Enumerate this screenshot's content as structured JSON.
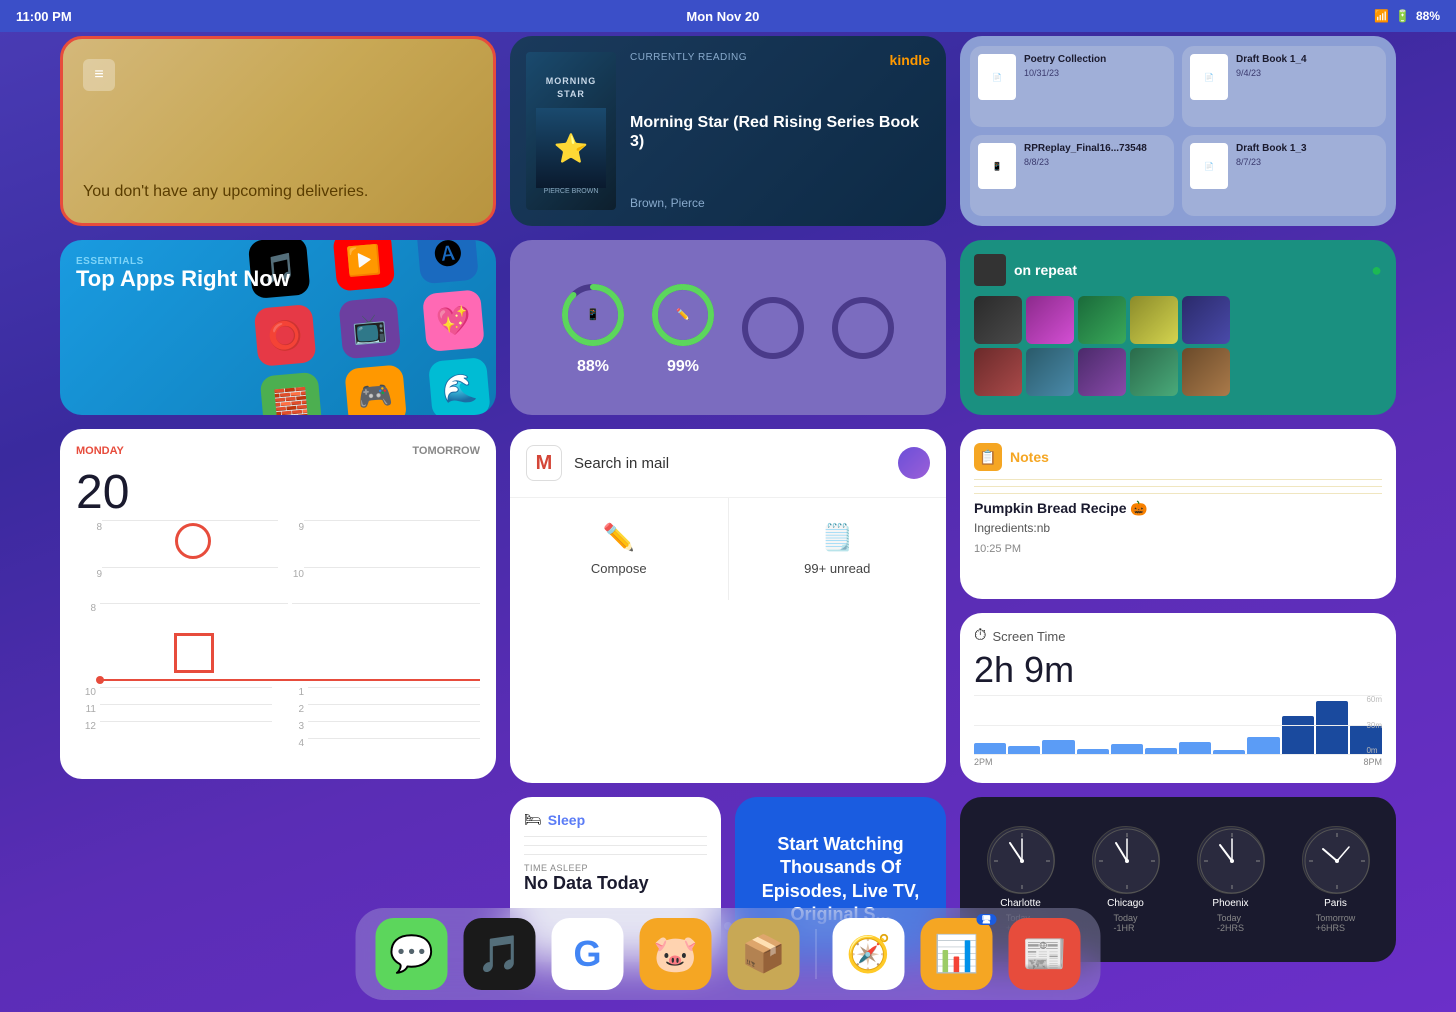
{
  "statusBar": {
    "time": "11:00 PM",
    "date": "Mon Nov 20",
    "wifi": "WiFi",
    "battery": "88%"
  },
  "delivery": {
    "message": "You don't have any upcoming deliveries."
  },
  "kindle": {
    "label": "CURRENTLY READING",
    "title": "Morning Star (Red Rising Series Book 3)",
    "author": "Brown, Pierce",
    "logo": "kindle"
  },
  "files": {
    "items": [
      {
        "name": "Poetry Collection",
        "date": "10/31/23"
      },
      {
        "name": "Draft Book 1_4",
        "date": "9/4/23"
      },
      {
        "name": "RPReplay_Final16...73548",
        "date": "8/8/23"
      },
      {
        "name": "Draft Book 1_3",
        "date": "8/7/23"
      }
    ]
  },
  "appstore": {
    "label": "ESSENTIALS",
    "title": "Top Apps Right Now"
  },
  "battery": {
    "devices": [
      {
        "pct": 88,
        "icon": "📱"
      },
      {
        "pct": 99,
        "icon": "✏️"
      }
    ]
  },
  "spotify": {
    "title": "on repeat"
  },
  "calendar": {
    "day": "MONDAY",
    "tomorrow": "TOMORROW",
    "date": "20",
    "times": [
      "8",
      "9",
      "10",
      "11",
      "12",
      "1",
      "2",
      "3",
      "4"
    ]
  },
  "gmail": {
    "placeholder": "Search in mail",
    "actions": [
      {
        "label": "Compose",
        "icon": "✏️"
      },
      {
        "label": "99+ unread",
        "icon": "📋"
      }
    ]
  },
  "notes": {
    "title": "Notes",
    "noteTitle": "Pumpkin Bread Recipe 🎃",
    "content": "Ingredients:nb",
    "time": "10:25 PM"
  },
  "screentime": {
    "title": "Screen Time",
    "duration": "2h 9m",
    "labels": [
      "2PM",
      "8PM"
    ],
    "gridLabels": [
      "60m",
      "30m",
      "0m"
    ]
  },
  "sleep": {
    "title": "Sleep",
    "sublabel": "TIME ASLEEP",
    "value": "No Data Today"
  },
  "ad": {
    "text": "Start Watching Thousands Of Episodes, Live TV, Original S..."
  },
  "clocks": [
    {
      "city": "Charlotte",
      "sub": "Today\n+0HRS"
    },
    {
      "city": "Chicago",
      "sub": "Today\n-1HR"
    },
    {
      "city": "Phoenix",
      "sub": "Today\n-2HRS"
    },
    {
      "city": "Paris",
      "sub": "Tomorrow\n+6HRS"
    }
  ],
  "dots": [
    true,
    false,
    false
  ],
  "dock": {
    "apps": [
      {
        "label": "Messages",
        "icon": "💬",
        "bg": "#5cd65c"
      },
      {
        "label": "Spotify",
        "icon": "🎵",
        "bg": "#1a1a1a"
      },
      {
        "label": "Google",
        "icon": "G",
        "bg": "white"
      },
      {
        "label": "Money",
        "icon": "🐷",
        "bg": "#f5a623"
      },
      {
        "label": "Deliveries",
        "icon": "📦",
        "bg": "#c8a855"
      },
      {
        "label": "Safari",
        "icon": "🧭",
        "bg": "white"
      },
      {
        "label": "Keewordz",
        "icon": "📊",
        "bg": "#f5a623"
      },
      {
        "label": "Flipboard",
        "icon": "📰",
        "bg": "#e74c3c",
        "badge": "📺"
      }
    ]
  }
}
